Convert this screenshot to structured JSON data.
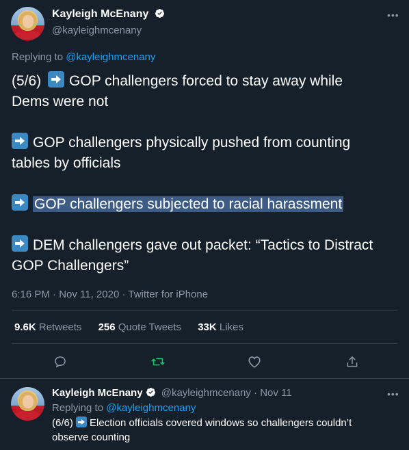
{
  "tweet": {
    "author_name": "Kayleigh McEnany",
    "author_handle": "@kayleighmcenany",
    "replying_prefix": "Replying to ",
    "replying_handle": "@kayleighmcenany",
    "lines": [
      "(5/6)",
      "GOP challengers forced to stay away while",
      "Dems were not",
      "GOP challengers physically pushed from counting",
      "tables by officials",
      "GOP challengers subjected to racial harassment",
      "DEM challengers gave out packet: “Tactics to Distract",
      "GOP Challengers”"
    ],
    "meta": "6:16 PM · Nov 11, 2020 · Twitter for iPhone",
    "stats": {
      "retweets_count": "9.6K",
      "retweets_label": "Retweets",
      "quotes_count": "256",
      "quotes_label": "Quote Tweets",
      "likes_count": "33K",
      "likes_label": "Likes"
    },
    "action_icons": [
      "reply-icon",
      "retweet-icon",
      "like-icon",
      "share-icon"
    ],
    "colors": {
      "background": "#15202b",
      "accent": "#1da1f2",
      "retweet": "#17bf63",
      "highlight": "#3d5b85"
    }
  },
  "reply": {
    "author_name": "Kayleigh McEnany",
    "author_handle": "@kayleighmcenany",
    "separator": " · ",
    "date": "Nov 11",
    "replying_prefix": "Replying to ",
    "replying_handle": "@kayleighmcenany",
    "prefix": "(6/6)",
    "text": "Election officials covered windows so challengers couldn’t",
    "text2": "observe counting"
  }
}
